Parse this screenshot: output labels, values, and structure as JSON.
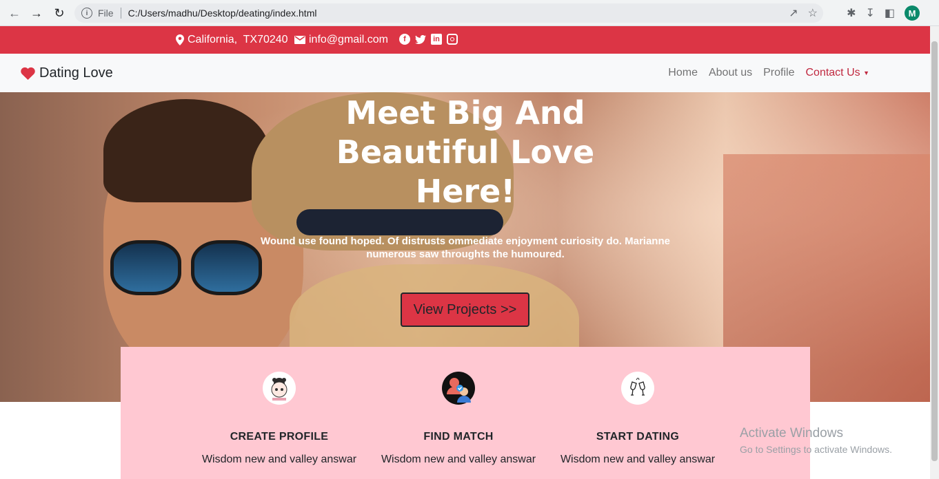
{
  "browser": {
    "file_label": "File",
    "url": "C:/Users/madhu/Desktop/deating/index.html",
    "profile_initial": "M"
  },
  "topbar": {
    "location": "California,  TX70240",
    "email": "info@gmail.com",
    "social_icons": [
      "facebook-icon",
      "twitter-icon",
      "linkedin-icon",
      "instagram-icon"
    ],
    "color": "#dc3545"
  },
  "navbar": {
    "brand": "Dating Love",
    "links": [
      "Home",
      "About us",
      "Profile"
    ],
    "dropdown": "Contact Us"
  },
  "hero": {
    "title_lines": [
      "Meet Big And",
      "Beautiful Love",
      "Here!"
    ],
    "text_line1": "Wound use found hoped. Of distrusts ommediate enjoyment curiosity do. Marianne",
    "text_line2": "numerous saw throughts the humoured.",
    "button": "View Projects >>"
  },
  "features": [
    {
      "title": "CREATE PROFILE",
      "text": "Wisdom new and valley answar",
      "icon": "girl-avatar-icon"
    },
    {
      "title": "FIND MATCH",
      "text": "Wisdom new and valley answar",
      "icon": "match-icon"
    },
    {
      "title": "START DATING",
      "text": "Wisdom new and valley answar",
      "icon": "cheers-icon"
    }
  ],
  "watermark": {
    "line1": "Activate Windows",
    "line2": "Go to Settings to activate Windows."
  }
}
